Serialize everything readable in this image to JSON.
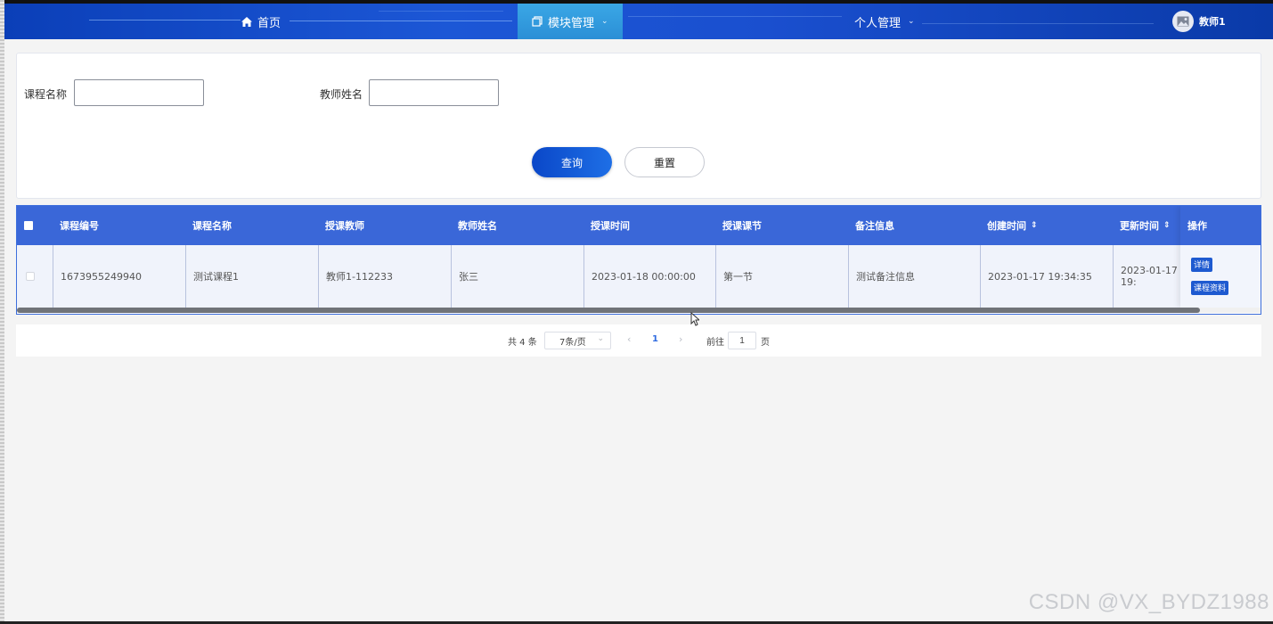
{
  "nav": {
    "home": "首页",
    "module": "模块管理",
    "personal": "个人管理",
    "user": "教师1"
  },
  "search": {
    "course_name_label": "课程名称",
    "course_name_value": "",
    "teacher_name_label": "教师姓名",
    "teacher_name_value": "",
    "query_button": "查询",
    "reset_button": "重置"
  },
  "table": {
    "columns": [
      "课程编号",
      "课程名称",
      "授课教师",
      "教师姓名",
      "授课时间",
      "授课课节",
      "备注信息",
      "创建时间",
      "更新时间",
      "操作"
    ],
    "rows": [
      {
        "course_id": "1673955249940",
        "course_name": "测试课程1",
        "teacher": "教师1-112233",
        "teacher_name": "张三",
        "lesson_time": "2023-01-18 00:00:00",
        "lesson_section": "第一节",
        "remark": "测试备注信息",
        "created": "2023-01-17 19:34:35",
        "updated": "2023-01-17 19:"
      }
    ],
    "actions": {
      "detail": "详情",
      "materials": "课程资料"
    }
  },
  "pagination": {
    "total": "共 4 条",
    "page_size": "7条/页",
    "current_page": "1",
    "goto_label": "前往",
    "goto_value": "1",
    "page_suffix": "页"
  },
  "watermark": "CSDN @VX_BYDZ1988",
  "colors": {
    "nav_bg": "#1c57d6",
    "nav_active": "#2b8fd6",
    "table_header": "#3a67d8",
    "primary": "#1e5ad0"
  }
}
